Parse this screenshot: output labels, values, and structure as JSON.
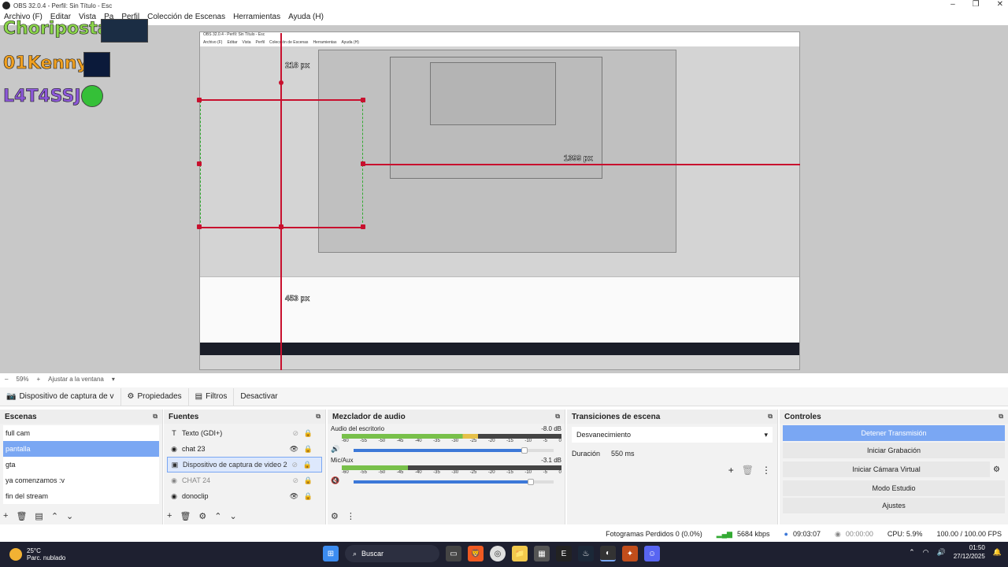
{
  "window": {
    "title": "OBS 32.0.4 - Perfil: Sin Título - Esc",
    "min": "–",
    "max": "❐",
    "close": "✕"
  },
  "menu": [
    "Archivo (F)",
    "Editar",
    "Vista",
    "Pa",
    "Perfil",
    "Colección de Escenas",
    "Herramientas",
    "Ayuda (H)"
  ],
  "preview": {
    "nicks": [
      "Choriposta:",
      "01Kenny:",
      "L4T4SSJ:"
    ],
    "measures": [
      "218 px",
      "1399 px",
      "453 px"
    ],
    "embedded_title": "OBS 32.0.4 - Perfil: Sin Título - Esc",
    "embedded_menu": [
      "Archivo (F)",
      "Editar",
      "Vista",
      "Perfil",
      "Colección de Escenas",
      "Herramientas",
      "Ayuda (H)"
    ]
  },
  "zoom": {
    "value": "59%",
    "fit_label": "Ajustar a la ventana"
  },
  "source_toolbar": {
    "source_name": "Dispositivo de captura de v",
    "properties": "Propiedades",
    "filters": "Filtros",
    "deactivate": "Desactivar"
  },
  "scenes": {
    "title": "Escenas",
    "items": [
      "full cam",
      "pantalla",
      "gta",
      "ya comenzamos :v",
      "fin del stream"
    ],
    "selected": "pantalla"
  },
  "sources": {
    "title": "Fuentes",
    "items": [
      {
        "label": "Texto (GDI+)",
        "icon": "text-icon",
        "visible": false
      },
      {
        "label": "chat 23",
        "icon": "browser-icon",
        "visible": true
      },
      {
        "label": "Dispositivo de captura de video 2",
        "icon": "camera-icon",
        "visible": false
      },
      {
        "label": "CHAT 24",
        "icon": "browser-icon",
        "visible": false
      },
      {
        "label": "donoclip",
        "icon": "browser-icon",
        "visible": true
      }
    ],
    "selected": "Dispositivo de captura de video 2"
  },
  "mixer": {
    "title": "Mezclador de audio",
    "tracks": [
      {
        "name": "Audio del escritorio",
        "db": "-8.0 dB",
        "level": 0.62,
        "volume": 0.84,
        "muted": false
      },
      {
        "name": "Mic/Aux",
        "db": "-3.1 dB",
        "level": 0.3,
        "volume": 0.87,
        "muted": true
      }
    ],
    "scale": [
      "-60",
      "-55",
      "-50",
      "-45",
      "-40",
      "-35",
      "-30",
      "-25",
      "-20",
      "-15",
      "-10",
      "-5",
      "0"
    ]
  },
  "transitions": {
    "title": "Transiciones de escena",
    "selected": "Desvanecimiento",
    "duration_label": "Duración",
    "duration": "550 ms"
  },
  "controls": {
    "title": "Controles",
    "buttons": [
      "Detener Transmisión",
      "Iniciar Grabación",
      "Iniciar Cámara Virtual",
      "Modo Estudio",
      "Ajustes"
    ]
  },
  "status": {
    "dropped": "Fotogramas Perdidos 0 (0.0%)",
    "bitrate": "5684 kbps",
    "stream_time": "09:03:07",
    "rec_time": "00:00:00",
    "cpu": "CPU: 5.9%",
    "fps": "100.00 / 100.00 FPS"
  },
  "taskbar": {
    "temp": "25°C",
    "weather": "Parc. nublado",
    "search": "Buscar",
    "time": "01:50",
    "date": "27/12/2025"
  }
}
